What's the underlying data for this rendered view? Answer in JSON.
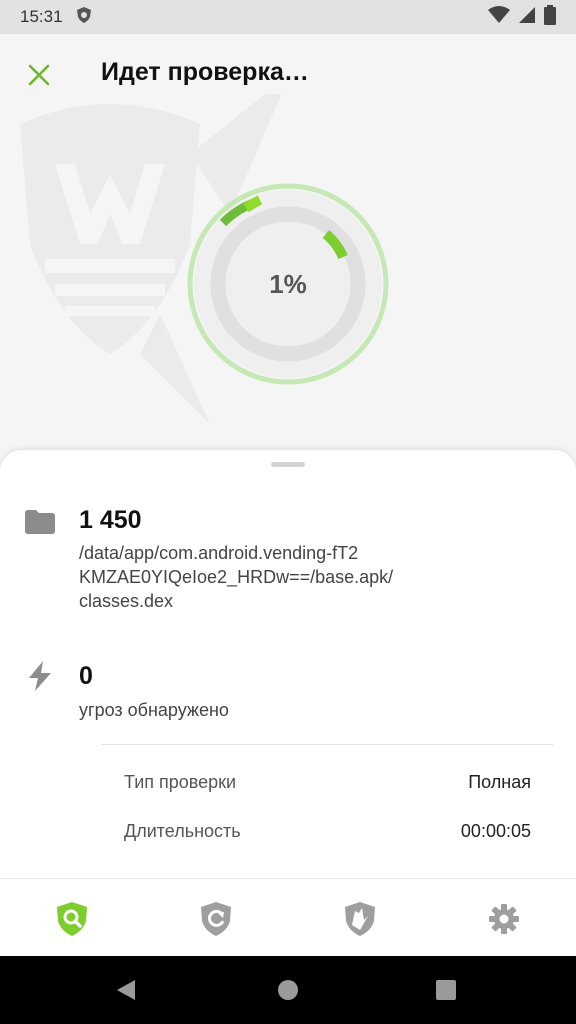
{
  "status_bar": {
    "time": "15:31",
    "icons": [
      "shield-lion-icon",
      "wifi-icon",
      "signal-icon",
      "battery-icon"
    ]
  },
  "header": {
    "title": "Идет проверка…",
    "close_icon": "close-icon"
  },
  "progress": {
    "label": "1%",
    "value": 0.01,
    "accent": "#7ccd2d",
    "ring_color": "#c6e8b4",
    "track_color": "#e3e3e3"
  },
  "scan": {
    "files_count": "1 450",
    "current_file": [
      "/data/app/com.android.vending-fT2",
      "KMZAE0YIQeIoe2_HRDw==/base.apk/",
      "classes.dex"
    ],
    "threats_count": "0",
    "threats_label": "угроз обнаружено"
  },
  "details": [
    {
      "label": "Тип проверки",
      "value": "Полная"
    },
    {
      "label": "Длительность",
      "value": "00:00:05"
    }
  ],
  "bottom_nav": [
    {
      "name": "scanner",
      "icon": "shield-search-icon",
      "active": true
    },
    {
      "name": "update",
      "icon": "shield-refresh-icon",
      "active": false
    },
    {
      "name": "firewall",
      "icon": "shield-wall-icon",
      "active": false
    },
    {
      "name": "settings",
      "icon": "gear-icon",
      "active": false
    }
  ],
  "colors": {
    "accent": "#7ccd2d",
    "icon_gray": "#9e9e9e"
  }
}
